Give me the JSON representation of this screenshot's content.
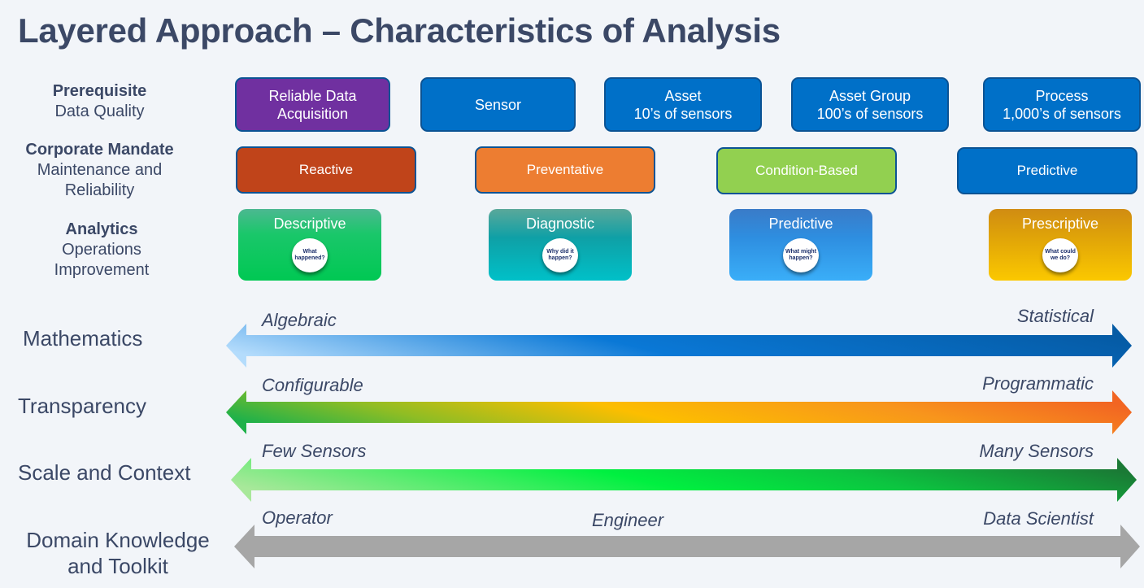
{
  "title": "Layered Approach – Characteristics of Analysis",
  "row_labels": {
    "prerequisite": {
      "bold": "Prerequisite",
      "sub": "Data Quality"
    },
    "corporate": {
      "bold": "Corporate Mandate",
      "sub1": "Maintenance and",
      "sub2": "Reliability"
    },
    "analytics": {
      "bold": "Analytics",
      "sub1": "Operations",
      "sub2": "Improvement"
    }
  },
  "prerequisite_boxes": [
    {
      "line1": "Reliable Data",
      "line2": "Acquisition",
      "color": "#7030a0"
    },
    {
      "line1": "Sensor",
      "line2": "",
      "color": "#0070c8"
    },
    {
      "line1": "Asset",
      "line2": "10’s of sensors",
      "color": "#0070c8"
    },
    {
      "line1": "Asset Group",
      "line2": "100’s of sensors",
      "color": "#0070c8"
    },
    {
      "line1": "Process",
      "line2": "1,000’s of sensors",
      "color": "#0070c8"
    }
  ],
  "mandate_boxes": [
    {
      "label": "Reactive",
      "color": "#c0441a"
    },
    {
      "label": "Preventative",
      "color": "#ed7d31"
    },
    {
      "label": "Condition-Based",
      "color": "#92d050"
    },
    {
      "label": "Predictive",
      "color": "#0070c8"
    }
  ],
  "analytics_boxes": [
    {
      "label": "Descriptive",
      "question": "What happened?"
    },
    {
      "label": "Diagnostic",
      "question": "Why did it happen?"
    },
    {
      "label": "Predictive",
      "question": "What might happen?"
    },
    {
      "label": "Prescriptive",
      "question": "What could we do?"
    }
  ],
  "spectrums": [
    {
      "name": "Mathematics",
      "left": "Algebraic",
      "middle": "",
      "right": "Statistical"
    },
    {
      "name": "Transparency",
      "left": "Configurable",
      "middle": "",
      "right": "Programmatic"
    },
    {
      "name": "Scale and Context",
      "left": "Few Sensors",
      "middle": "",
      "right": "Many Sensors"
    },
    {
      "name": "Domain Knowledge and Toolkit",
      "name1": "Domain Knowledge",
      "name2": "and Toolkit",
      "left": "Operator",
      "middle": "Engineer",
      "right": "Data Scientist"
    }
  ]
}
